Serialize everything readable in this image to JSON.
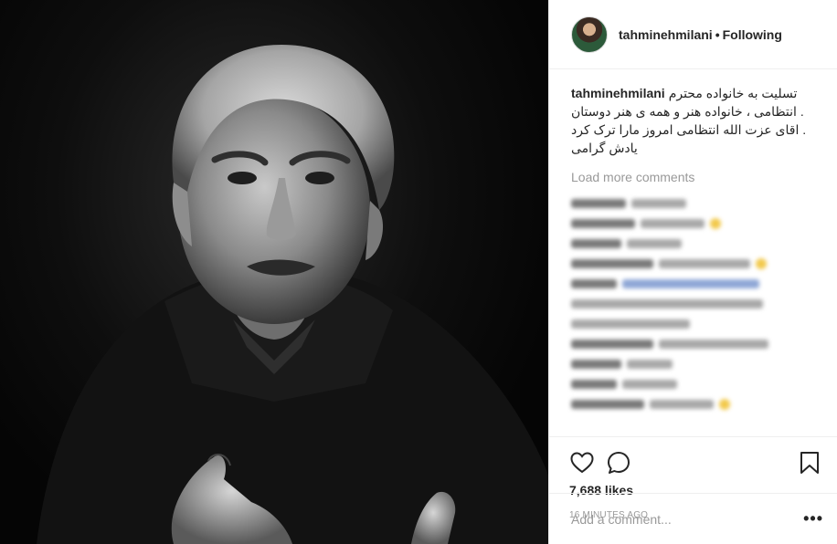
{
  "post": {
    "username": "tahminehmilani",
    "separator": "•",
    "follow_status": "Following",
    "caption_lines": [
      "تسلیت به خانواده محترم",
      ". انتظامی ، خانواده هنر و همه ی هنر دوستان",
      ". اقای عزت الله انتظامی امروز مارا ترک کرد",
      "یادش گرامی"
    ],
    "load_more_label": "Load more comments",
    "likes": "7,688 likes",
    "time_ago": "16 MINUTES AGO",
    "comment_placeholder": "Add a comment...",
    "more_options": "•••"
  },
  "icons": {
    "like": "heart-icon",
    "comment": "comment-bubble-icon",
    "save": "bookmark-icon",
    "avatar": "profile-avatar"
  },
  "colors": {
    "text": "#262626",
    "muted": "#999999",
    "border": "#efefef"
  }
}
